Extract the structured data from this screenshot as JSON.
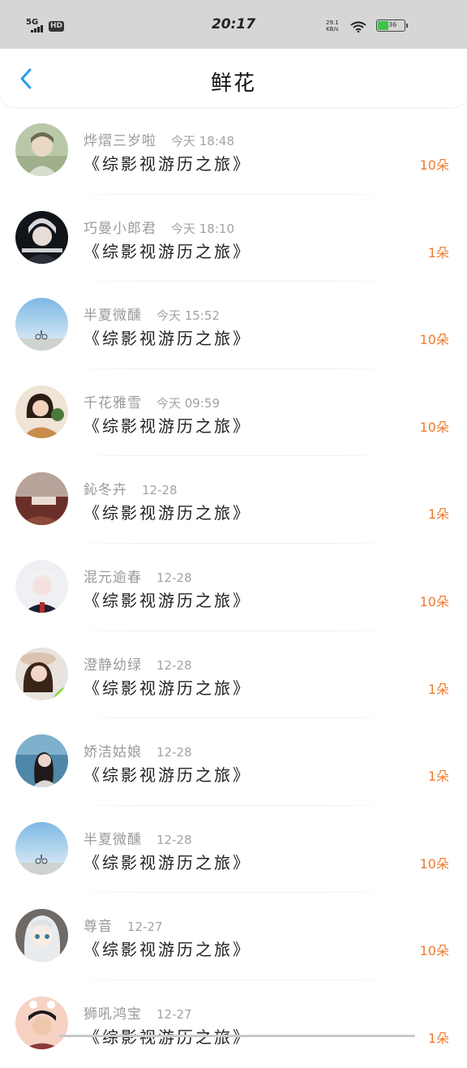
{
  "status": {
    "network": "5G",
    "hd": "HD",
    "time": "20:17",
    "speed_value": "29.1",
    "speed_unit": "KB/s",
    "battery": "36"
  },
  "header": {
    "title": "鲜花",
    "back_icon": "chevron-left-icon"
  },
  "colors": {
    "accent": "#2d9cf0",
    "count": "#f07a2c"
  },
  "items": [
    {
      "name": "烨熠三岁啦",
      "time": "今天 18:48",
      "book": "《综影视游历之旅》",
      "count": "10朵"
    },
    {
      "name": "巧曼小郎君",
      "time": "今天 18:10",
      "book": "《综影视游历之旅》",
      "count": "1朵"
    },
    {
      "name": "半夏微醺",
      "time": "今天 15:52",
      "book": "《综影视游历之旅》",
      "count": "10朵"
    },
    {
      "name": "千花雅雪",
      "time": "今天 09:59",
      "book": "《综影视游历之旅》",
      "count": "10朵"
    },
    {
      "name": "鈊冬卉",
      "time": "12-28",
      "book": "《综影视游历之旅》",
      "count": "1朵"
    },
    {
      "name": "混元逾春",
      "time": "12-28",
      "book": "《综影视游历之旅》",
      "count": "10朵"
    },
    {
      "name": "澄静幼绿",
      "time": "12-28",
      "book": "《综影视游历之旅》",
      "count": "1朵"
    },
    {
      "name": "娇洁姑娘",
      "time": "12-28",
      "book": "《综影视游历之旅》",
      "count": "1朵"
    },
    {
      "name": "半夏微醺",
      "time": "12-28",
      "book": "《综影视游历之旅》",
      "count": "10朵"
    },
    {
      "name": "尊音",
      "time": "12-27",
      "book": "《综影视游历之旅》",
      "count": "10朵"
    },
    {
      "name": "狮吼鸿宝",
      "time": "12-27",
      "book": "《综影视游历之旅》",
      "count": "1朵"
    }
  ]
}
